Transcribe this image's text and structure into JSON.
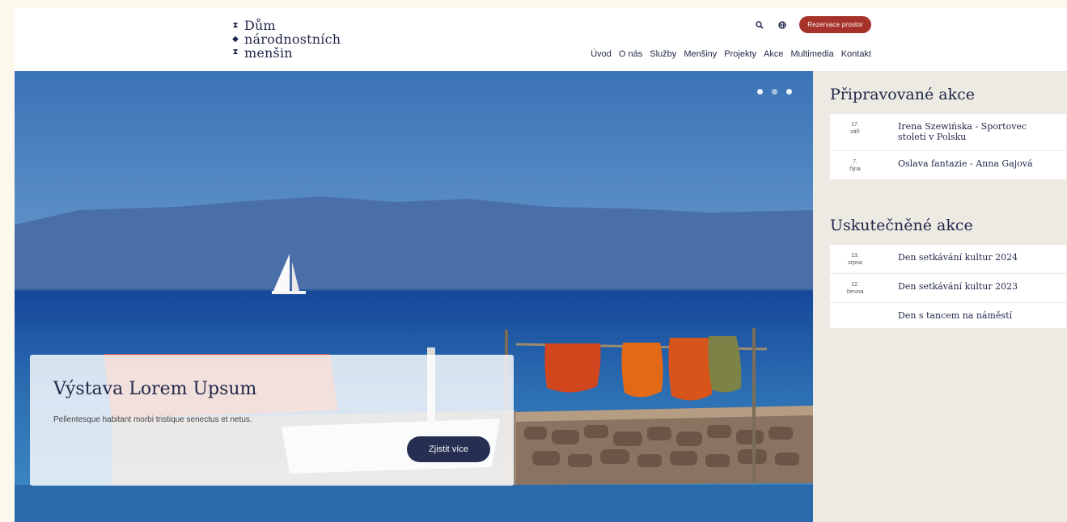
{
  "brand": {
    "lines": [
      "Dům",
      "národnostních",
      "menšin"
    ]
  },
  "header": {
    "cta_label": "Rezervace prostor",
    "nav": [
      "Úvod",
      "O nás",
      "Služby",
      "Menšiny",
      "Projekty",
      "Akce",
      "Multimedia",
      "Kontakt"
    ]
  },
  "hero": {
    "title": "Výstava Lorem Upsum",
    "text": "Pellentesque habitant morbi tristique senectus et netus.",
    "button_label": "Zjistit více",
    "slides": 3,
    "active_slide": 1
  },
  "upcoming": {
    "heading": "Připravované akce",
    "events": [
      {
        "day": "17.",
        "month": "září",
        "title": "Irena Szewińska - Sportovec století v Polsku"
      },
      {
        "day": "7.",
        "month": "října",
        "title": "Oslava fantazie - Anna Gajová"
      }
    ]
  },
  "past": {
    "heading": "Uskutečněné akce",
    "events": [
      {
        "day": "13.",
        "month": "srpna",
        "title": "Den setkávání kultur 2024"
      },
      {
        "day": "12.",
        "month": "června",
        "title": "Den setkávání kultur 2023"
      },
      {
        "day": "",
        "month": "",
        "title": "Den s tancem na náměstí"
      }
    ]
  },
  "colors": {
    "navy": "#1f2748",
    "cta": "#a6322a",
    "button": "#262e52",
    "sidebar_bg": "#ede9e3"
  },
  "icons": [
    "search-icon",
    "globe-icon",
    "diamond-mark-icon"
  ]
}
